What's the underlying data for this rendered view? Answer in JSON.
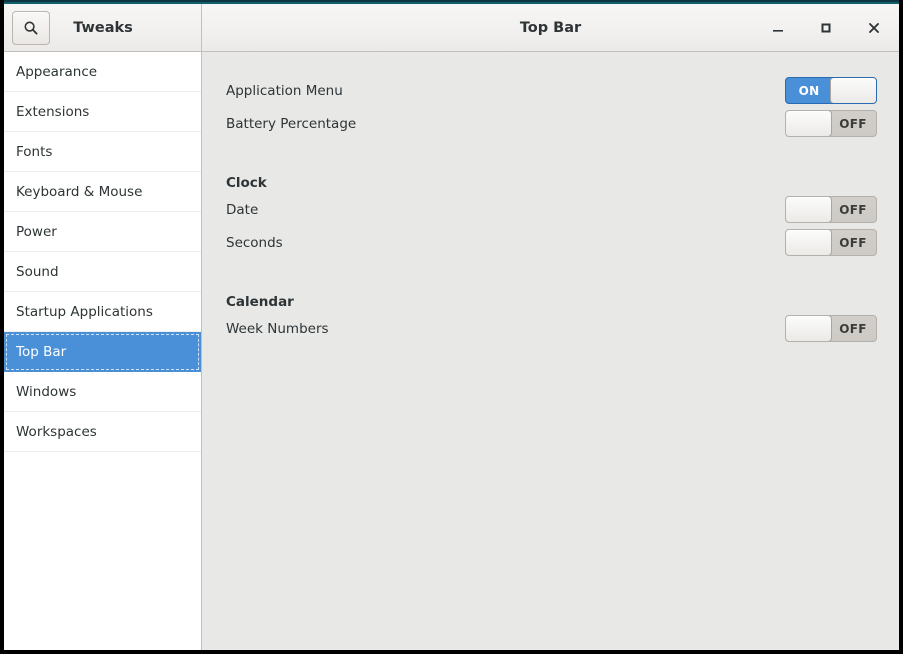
{
  "window": {
    "app_title": "Tweaks",
    "page_title": "Top Bar",
    "accent_color": "#10606e",
    "selection_color": "#4a90d9"
  },
  "header": {
    "search_icon": "search-icon",
    "controls": {
      "minimize": "–",
      "maximize": "□",
      "close": "✕"
    }
  },
  "sidebar": {
    "items": [
      {
        "label": "Appearance",
        "selected": false
      },
      {
        "label": "Extensions",
        "selected": false
      },
      {
        "label": "Fonts",
        "selected": false
      },
      {
        "label": "Keyboard & Mouse",
        "selected": false
      },
      {
        "label": "Power",
        "selected": false
      },
      {
        "label": "Sound",
        "selected": false
      },
      {
        "label": "Startup Applications",
        "selected": false
      },
      {
        "label": "Top Bar",
        "selected": true
      },
      {
        "label": "Windows",
        "selected": false
      },
      {
        "label": "Workspaces",
        "selected": false
      }
    ]
  },
  "main": {
    "rows": [
      {
        "label": "Application Menu",
        "state": "ON"
      },
      {
        "label": "Battery Percentage",
        "state": "OFF"
      }
    ],
    "clock_section": {
      "heading": "Clock",
      "rows": [
        {
          "label": "Date",
          "state": "OFF"
        },
        {
          "label": "Seconds",
          "state": "OFF"
        }
      ]
    },
    "calendar_section": {
      "heading": "Calendar",
      "rows": [
        {
          "label": "Week Numbers",
          "state": "OFF"
        }
      ]
    }
  }
}
